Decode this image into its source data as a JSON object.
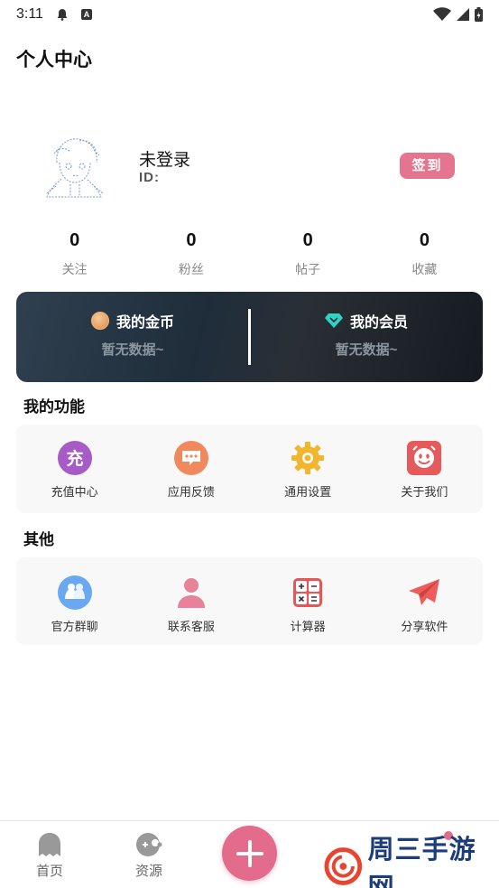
{
  "status_bar": {
    "time": "3:11",
    "input_badge": "A"
  },
  "header": {
    "title": "个人中心"
  },
  "profile": {
    "name": "未登录",
    "id_label": "ID:",
    "signin_label": "签到"
  },
  "stats": [
    {
      "value": "0",
      "label": "关注"
    },
    {
      "value": "0",
      "label": "粉丝"
    },
    {
      "value": "0",
      "label": "帖子"
    },
    {
      "value": "0",
      "label": "收藏"
    }
  ],
  "vip_card": {
    "coins": {
      "title": "我的金币",
      "sub": "暂无数据~"
    },
    "member": {
      "title": "我的会员",
      "sub": "暂无数据~"
    }
  },
  "functions": {
    "title": "我的功能",
    "items": [
      {
        "label": "充值中心",
        "icon": "recharge-icon",
        "glyph": "充"
      },
      {
        "label": "应用反馈",
        "icon": "feedback-icon"
      },
      {
        "label": "通用设置",
        "icon": "settings-gear-icon"
      },
      {
        "label": "关于我们",
        "icon": "smiley-icon"
      }
    ]
  },
  "others": {
    "title": "其他",
    "items": [
      {
        "label": "官方群聊",
        "icon": "group-chat-icon"
      },
      {
        "label": "联系客服",
        "icon": "customer-service-icon"
      },
      {
        "label": "计算器",
        "icon": "calculator-icon"
      },
      {
        "label": "分享软件",
        "icon": "share-paper-plane-icon"
      }
    ]
  },
  "tabbar": {
    "items": [
      {
        "label": "首页",
        "icon": "ghost-icon"
      },
      {
        "label": "资源",
        "icon": "gamepad-icon"
      }
    ]
  },
  "watermark": {
    "text": "周三手游网"
  },
  "colors": {
    "accent": "#e36b8c",
    "signin": "#e5748f",
    "card_dark": "#1f2d3a"
  }
}
